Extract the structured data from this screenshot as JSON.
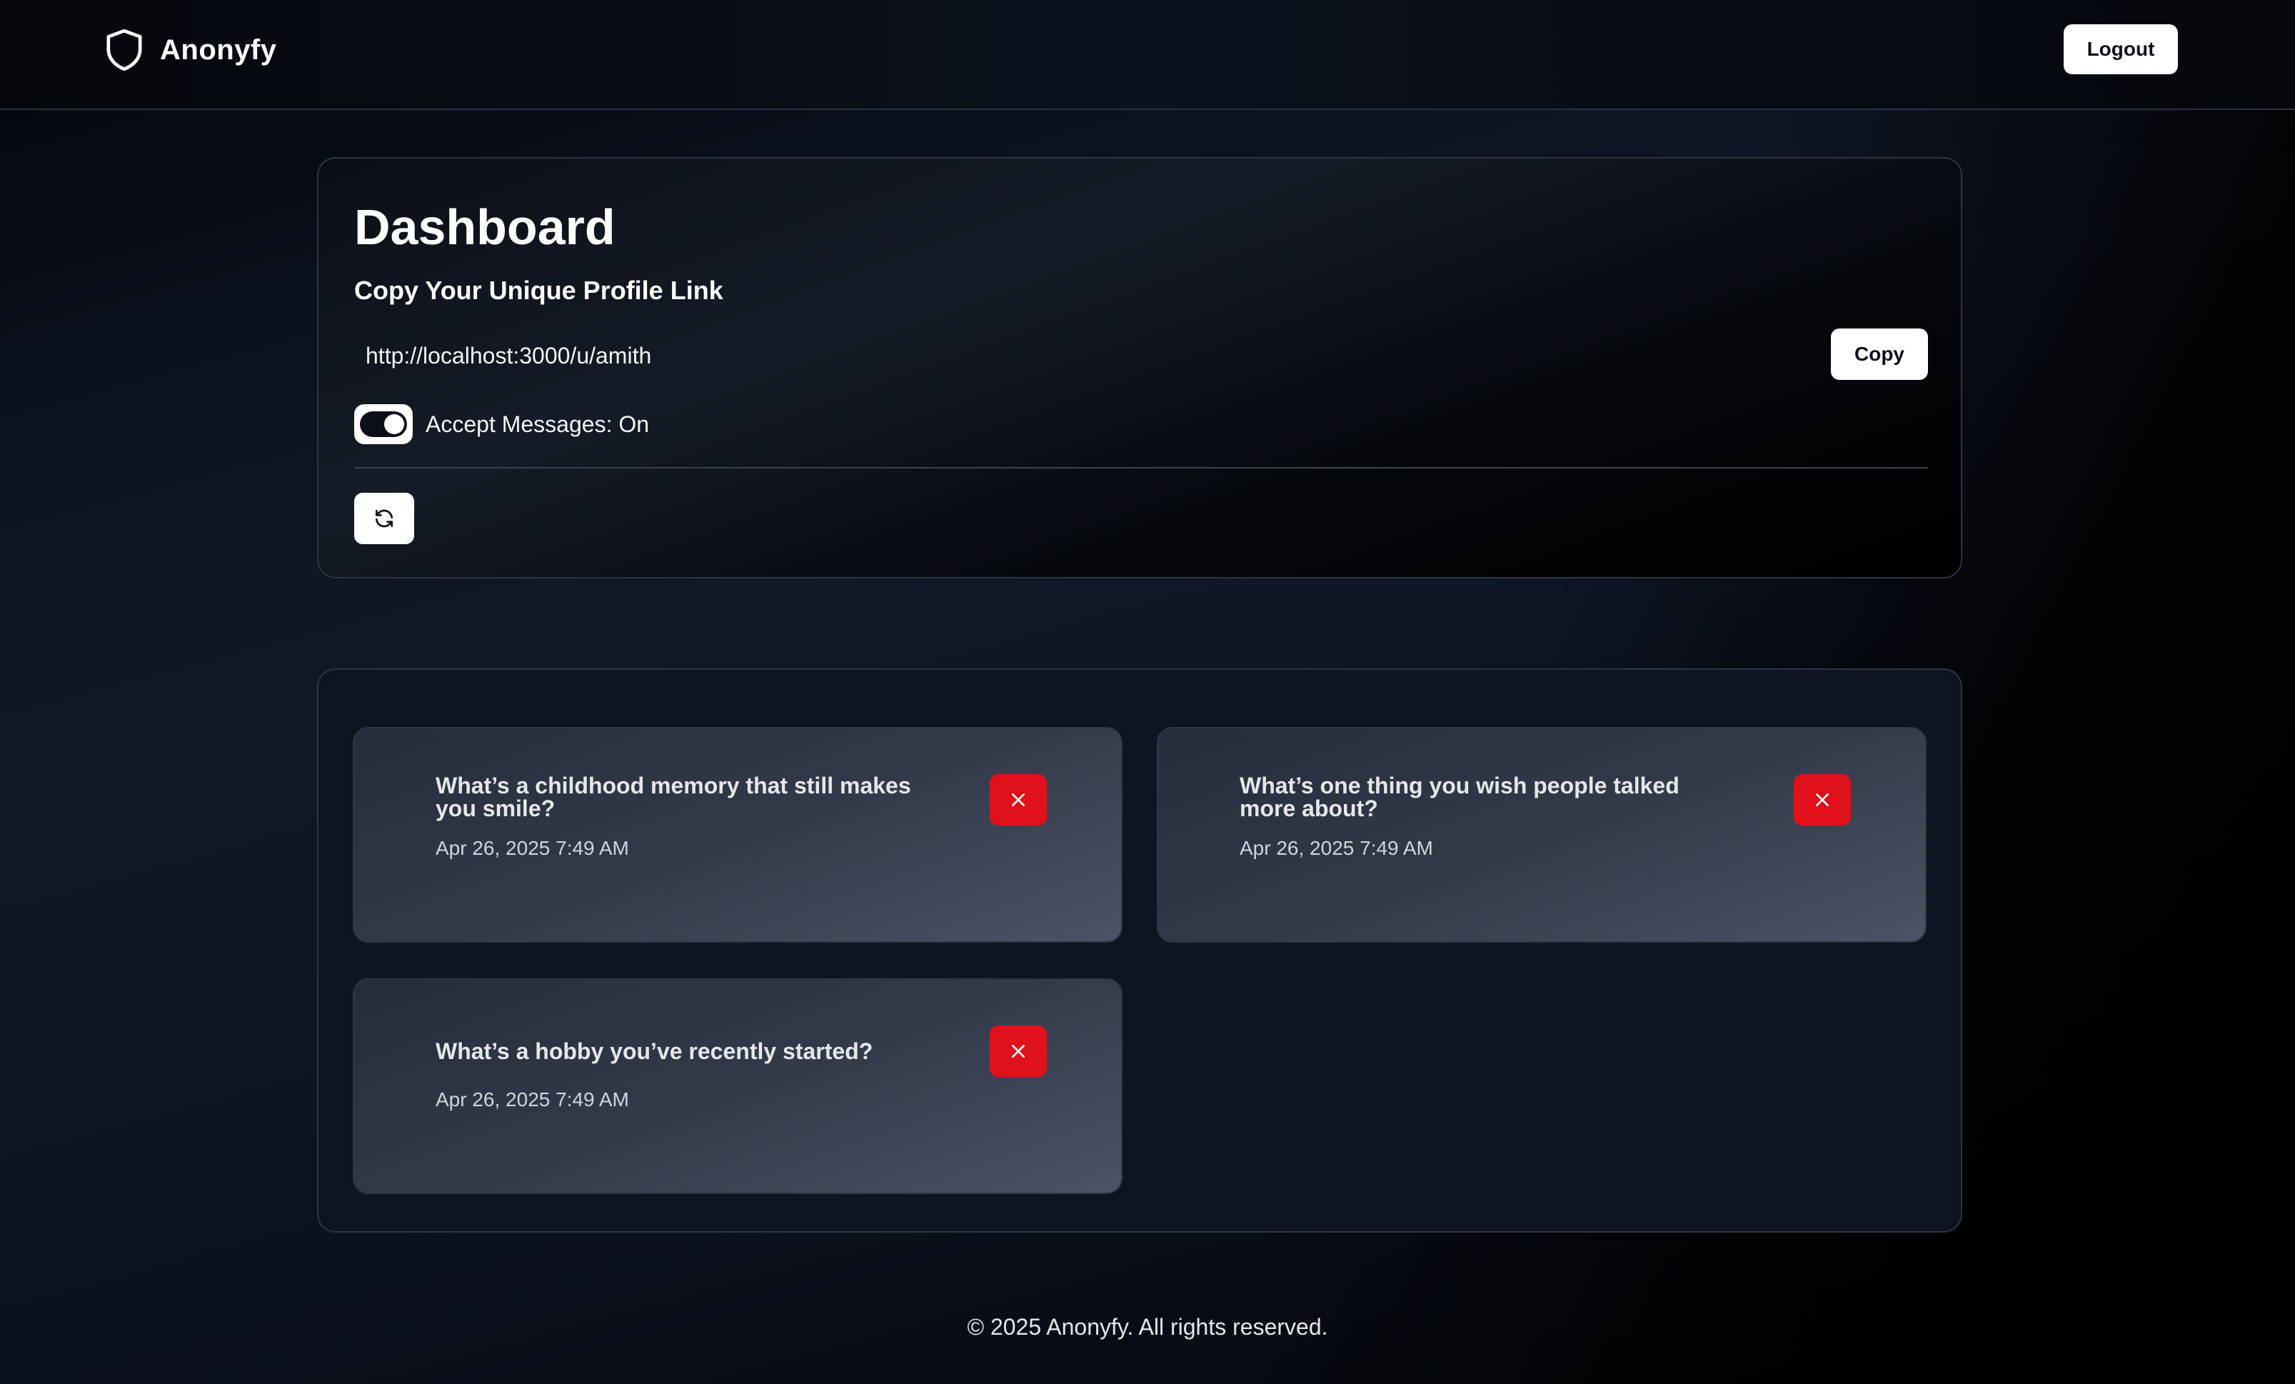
{
  "header": {
    "brand_name": "Anonyfy",
    "brand_icon": "shield-icon",
    "logout_label": "Logout"
  },
  "dashboard": {
    "title": "Dashboard",
    "subtitle": "Copy Your Unique Profile Link",
    "profile_link": "http://localhost:3000/u/amith",
    "copy_label": "Copy",
    "accept_messages_label": "Accept Messages: On",
    "accept_messages_on": true,
    "refresh_icon": "refresh-icon"
  },
  "messages": [
    {
      "text": "What’s a childhood memory that still makes you smile?",
      "date": "Apr 26, 2025 7:49 AM"
    },
    {
      "text": "What’s one thing you wish people talked more about?",
      "date": "Apr 26, 2025 7:49 AM"
    },
    {
      "text": "What’s a hobby you’ve recently started?",
      "date": "Apr 26, 2025 7:49 AM"
    }
  ],
  "footer": {
    "copyright": "© 2025 Anonyfy. All rights reserved."
  },
  "colors": {
    "background": "#0b111d",
    "delete_button": "#e0111b",
    "button_bg": "#ffffff",
    "card_border": "#2d3544"
  }
}
